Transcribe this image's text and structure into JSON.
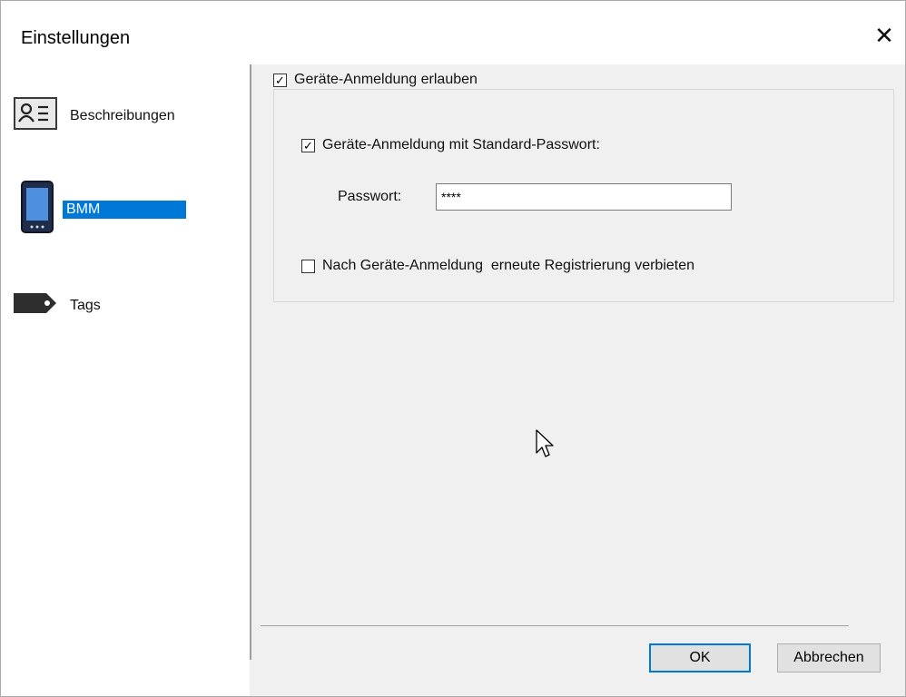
{
  "window": {
    "title": "Einstellungen",
    "close_symbol": "✕"
  },
  "sidebar": {
    "items": [
      {
        "label": "Beschreibungen",
        "icon": "contact-card-icon",
        "selected": false
      },
      {
        "label": "BMM",
        "icon": "mobile-device-icon",
        "selected": true
      },
      {
        "label": "Tags",
        "icon": "tag-icon",
        "selected": false
      }
    ]
  },
  "settings": {
    "allow_device_login": {
      "label": "Geräte-Anmeldung erlauben",
      "checked": true
    },
    "default_password_login": {
      "label": "Geräte-Anmeldung mit Standard-Passwort:",
      "checked": true
    },
    "password": {
      "label": "Passwort:",
      "value": "****"
    },
    "forbid_reregistration": {
      "label": "Nach Geräte-Anmeldung  erneute Registrierung verbieten",
      "checked": false
    }
  },
  "buttons": {
    "ok": "OK",
    "cancel": "Abbrechen"
  },
  "colors": {
    "selection": "#0078d7",
    "background": "#f0f0f0",
    "sidebar": "#ffffff"
  }
}
